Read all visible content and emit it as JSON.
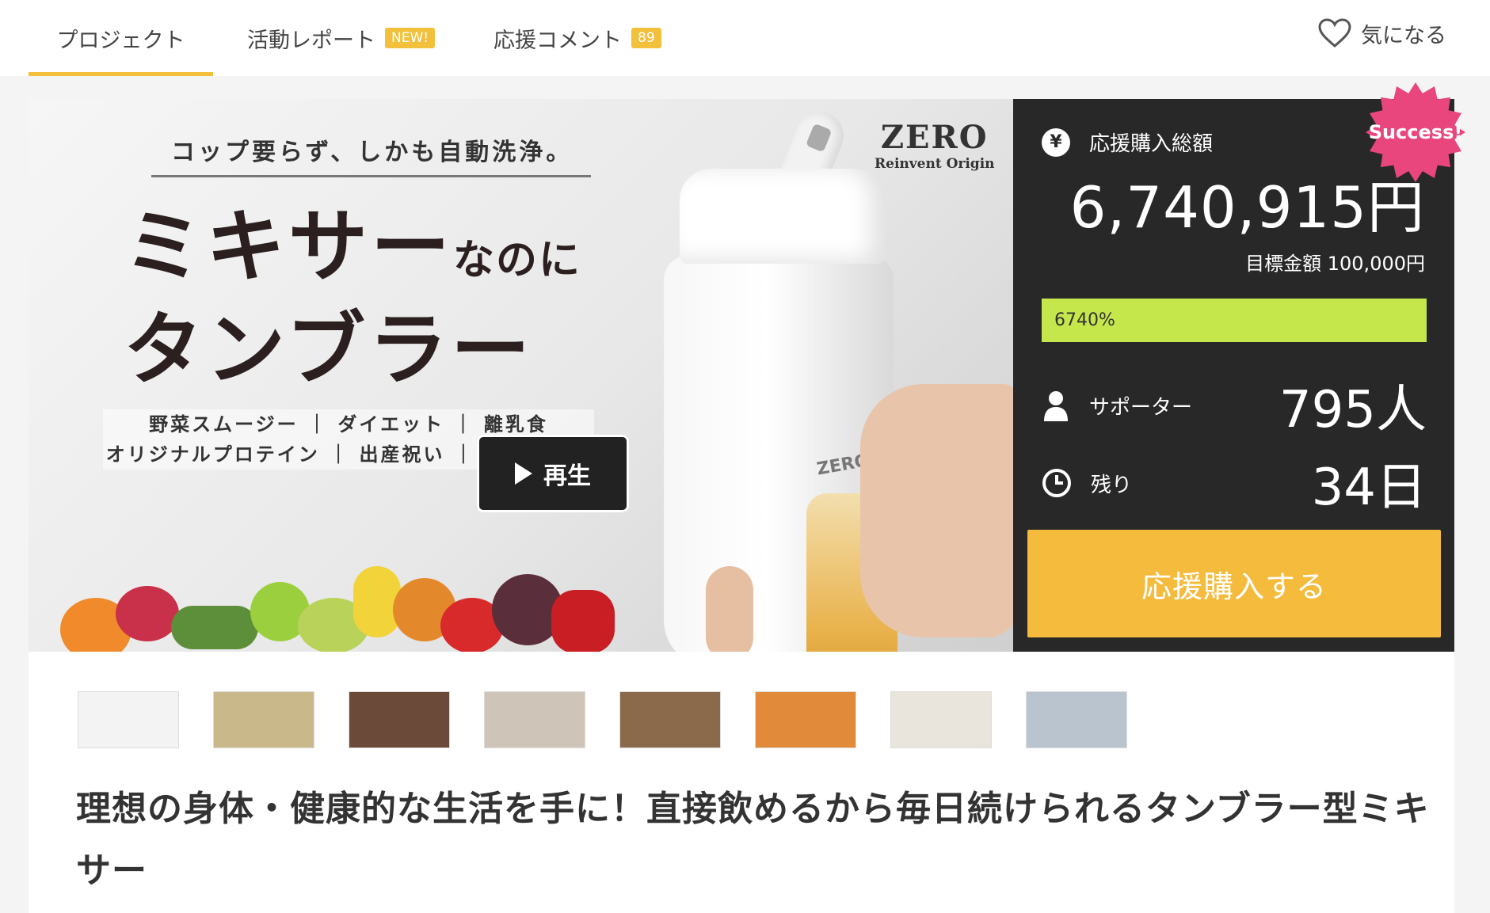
{
  "nav": {
    "tabs": [
      {
        "label": "プロジェクト"
      },
      {
        "label": "活動レポート",
        "badge": "NEW!"
      },
      {
        "label": "応援コメント",
        "badge": "89"
      }
    ],
    "favorite_label": "気になる"
  },
  "hero": {
    "tagline": "コップ要らず、しかも自動洗浄。",
    "headline_1": "ミキサー",
    "headline_1_small": "なのに",
    "headline_2": "タンブラー",
    "uses_1": "野菜スムージー ｜ ダイエット ｜ 離乳食",
    "uses_2": "オリジナルプロテイン ｜ 出産祝い ｜ 流動食など",
    "logo_mark": "ZERO",
    "logo_sub": "Reinvent Origin",
    "product_brand": "ZERO",
    "play_label": "再生"
  },
  "stats": {
    "total_icon": "¥",
    "total_label": "応援購入総額",
    "total_amount": "6,740,915円",
    "goal_text": "目標金額 100,000円",
    "progress_text": "6740%",
    "progress_fraction": 1.0,
    "supporters_label": "サポーター",
    "supporters_value": "795人",
    "remaining_label": "残り",
    "remaining_value": "34日",
    "support_button": "応援購入する",
    "success_badge": "Success!"
  },
  "gallery": {
    "thumbnails": [
      {
        "name": "thumb-1",
        "color": "#f3f3f3"
      },
      {
        "name": "thumb-2",
        "color": "#c9b98a"
      },
      {
        "name": "thumb-3",
        "color": "#6b4a3a"
      },
      {
        "name": "thumb-4",
        "color": "#cfc4b8"
      },
      {
        "name": "thumb-5",
        "color": "#8a6a4a"
      },
      {
        "name": "thumb-6",
        "color": "#e08a3a"
      },
      {
        "name": "thumb-7",
        "color": "#e9e4dc"
      },
      {
        "name": "thumb-8",
        "color": "#b9c4cf"
      }
    ]
  },
  "project_title": "理想の身体・健康的な生活を手に！直接飲めるから毎日続けられるタンブラー型ミキサー",
  "colors": {
    "accent": "#f2c03a",
    "button": "#f4bb3d",
    "progress": "#c5e74c",
    "panel": "#282828",
    "success": "#e8467c"
  }
}
